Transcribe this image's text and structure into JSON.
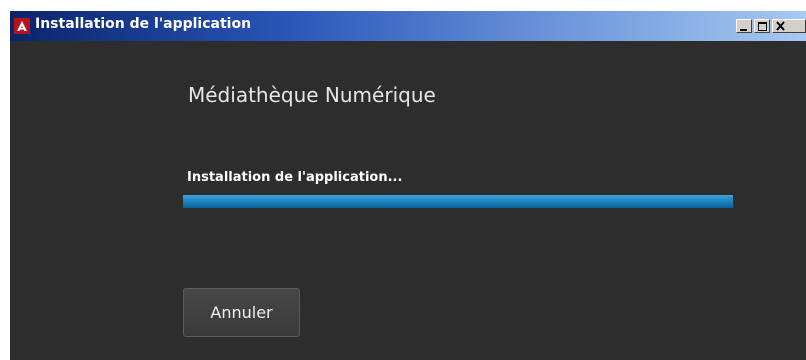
{
  "window": {
    "title": "Installation de l'application",
    "controls": {
      "minimize": "minimize-icon",
      "maximize": "maximize-icon",
      "close": "close-icon"
    }
  },
  "installer": {
    "product_name": "Médiathèque Numérique",
    "status_text": "Installation de l'application...",
    "progress_fraction": 1.0,
    "cancel_label": "Annuler"
  },
  "colors": {
    "background": "#2d2d2d",
    "progress_fill": "#1f86c4",
    "title_gradient_start": "#0a246a",
    "title_gradient_end": "#a6caf0"
  }
}
